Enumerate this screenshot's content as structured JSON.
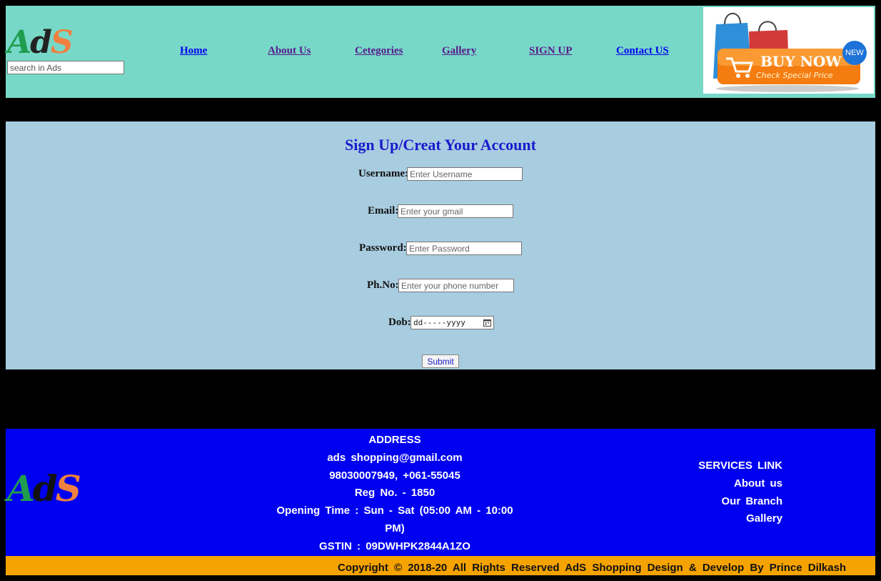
{
  "header": {
    "logo": {
      "part1": "A",
      "part2": "d",
      "part3": "S"
    },
    "search_placeholder": "search in Ads",
    "nav": [
      {
        "label": "Home",
        "color": "#0000ee"
      },
      {
        "label": "About Us",
        "color": "#551a8b"
      },
      {
        "label": "Cetegories",
        "color": "#551a8b"
      },
      {
        "label": "Gallery",
        "color": "#551a8b"
      },
      {
        "label": "SIGN UP",
        "color": "#551a8b"
      },
      {
        "label": "Contact US",
        "color": "#0000ee"
      }
    ],
    "promo": {
      "button_text": "BUY NOW",
      "subtext": "Check Special Price",
      "badge": "NEW"
    }
  },
  "form": {
    "title": "Sign Up/Creat Your Account",
    "fields": [
      {
        "label": "Username:",
        "placeholder": "Enter Username"
      },
      {
        "label": "Email:",
        "placeholder": "Enter your gmail"
      },
      {
        "label": "Password:",
        "placeholder": "Enter Password"
      },
      {
        "label": "Ph.No:",
        "placeholder": "Enter your phone number"
      },
      {
        "label": "Dob:",
        "placeholder": "dd-----yyyy"
      }
    ],
    "submit_label": "Submit"
  },
  "footer": {
    "logo": {
      "part1": "A",
      "part2": "d",
      "part3": "S"
    },
    "address": {
      "heading": "ADDRESS",
      "email": "ads shopping@gmail.com",
      "phone": "98030007949, +061-55045",
      "reg": "Reg No. - 1850",
      "hours": "Opening Time : Sun - Sat (05:00 AM - 10:00 PM)",
      "gstin": "GSTIN : 09DWHPK2844A1ZO"
    },
    "services": {
      "heading": "SERVICES LINK",
      "links": [
        "About us",
        "Our Branch",
        "Gallery"
      ]
    },
    "copyright": "Copyright © 2018-20 All Rights Reserved AdS Shopping Design & Develop By Prince Dilkash"
  },
  "colors": {
    "header_bg": "#78d8c8",
    "form_bg": "#a8cce0",
    "footer_bg": "#0000f0",
    "copyright_bg": "#f5a300",
    "title_color": "#1a1acc"
  }
}
